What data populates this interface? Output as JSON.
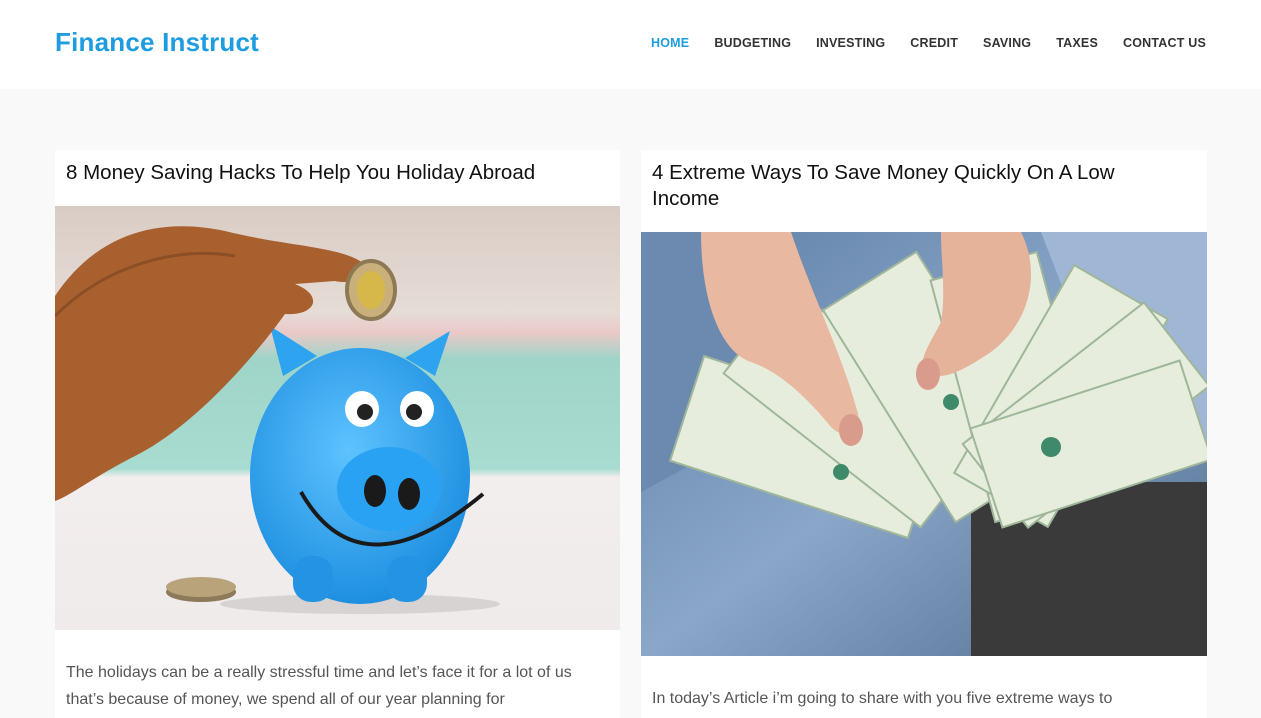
{
  "site": {
    "title": "Finance Instruct"
  },
  "nav": {
    "items": [
      {
        "label": "HOME"
      },
      {
        "label": "BUDGETING"
      },
      {
        "label": "INVESTING"
      },
      {
        "label": "CREDIT"
      },
      {
        "label": "SAVING"
      },
      {
        "label": "TAXES"
      },
      {
        "label": "CONTACT US"
      }
    ],
    "active_color": "#1e9ce0"
  },
  "posts": [
    {
      "title": "8 Money Saving Hacks To Help You Holiday Abroad",
      "image": "piggy-bank-photo",
      "excerpt": "The holidays can be a really stressful time and let’s face it for a lot of us that’s because of money, we spend all of our year planning for"
    },
    {
      "title": "4 Extreme Ways To Save Money Quickly On A Low Income",
      "image": "cash-fan-photo",
      "excerpt": "In today’s Article i’m going to share with you five extreme ways to"
    }
  ]
}
